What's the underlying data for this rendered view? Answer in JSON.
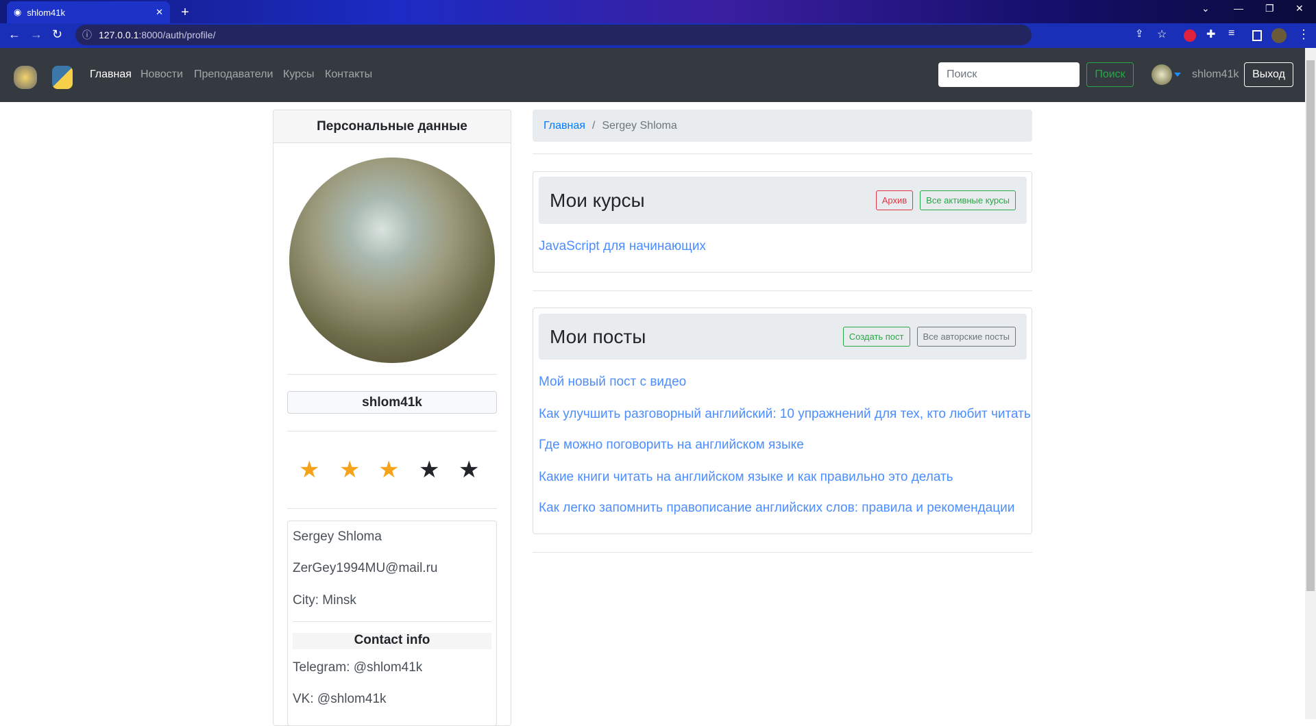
{
  "browser": {
    "tab_title": "shlom41k",
    "url_host": "127.0.0.1",
    "url_rest": ":8000/auth/profile/"
  },
  "navbar": {
    "links": [
      "Главная",
      "Новости",
      "Преподаватели",
      "Курсы",
      "Контакты"
    ],
    "search_placeholder": "Поиск",
    "search_button": "Поиск",
    "username": "shlom41k",
    "logout": "Выход"
  },
  "profile": {
    "header": "Персональные данные",
    "username": "shlom41k",
    "rating": 3,
    "rating_max": 5,
    "full_name": "Sergey Shloma",
    "email": "ZerGey1994MU@mail.ru",
    "city": "City: Minsk",
    "contact_title": "Contact info",
    "telegram": "Telegram: @shlom41k",
    "vk": "VK: @shlom41k"
  },
  "breadcrumb": {
    "home": "Главная",
    "sep": "/",
    "current": "Sergey Shloma"
  },
  "courses": {
    "title": "Мои курсы",
    "archive": "Архив",
    "all_active": "Все активные курсы",
    "items": [
      "JavaScript для начинающих"
    ]
  },
  "posts": {
    "title": "Мои посты",
    "create": "Создать пост",
    "all_posts": "Все авторские посты",
    "items": [
      "Мой новый пост с видео",
      "Как улучшить разговорный английский: 10 упражнений для тех, кто любит читать",
      "Где можно поговорить на английском языке",
      "Какие книги читать на английском языке и как правильно это делать",
      "Как легко запомнить правописание английских слов: правила и рекомендации"
    ]
  },
  "colors": {
    "star_on": "#f5a31a",
    "star_off": "#212529",
    "link": "#4c8dff",
    "navbar": "#343a40"
  }
}
